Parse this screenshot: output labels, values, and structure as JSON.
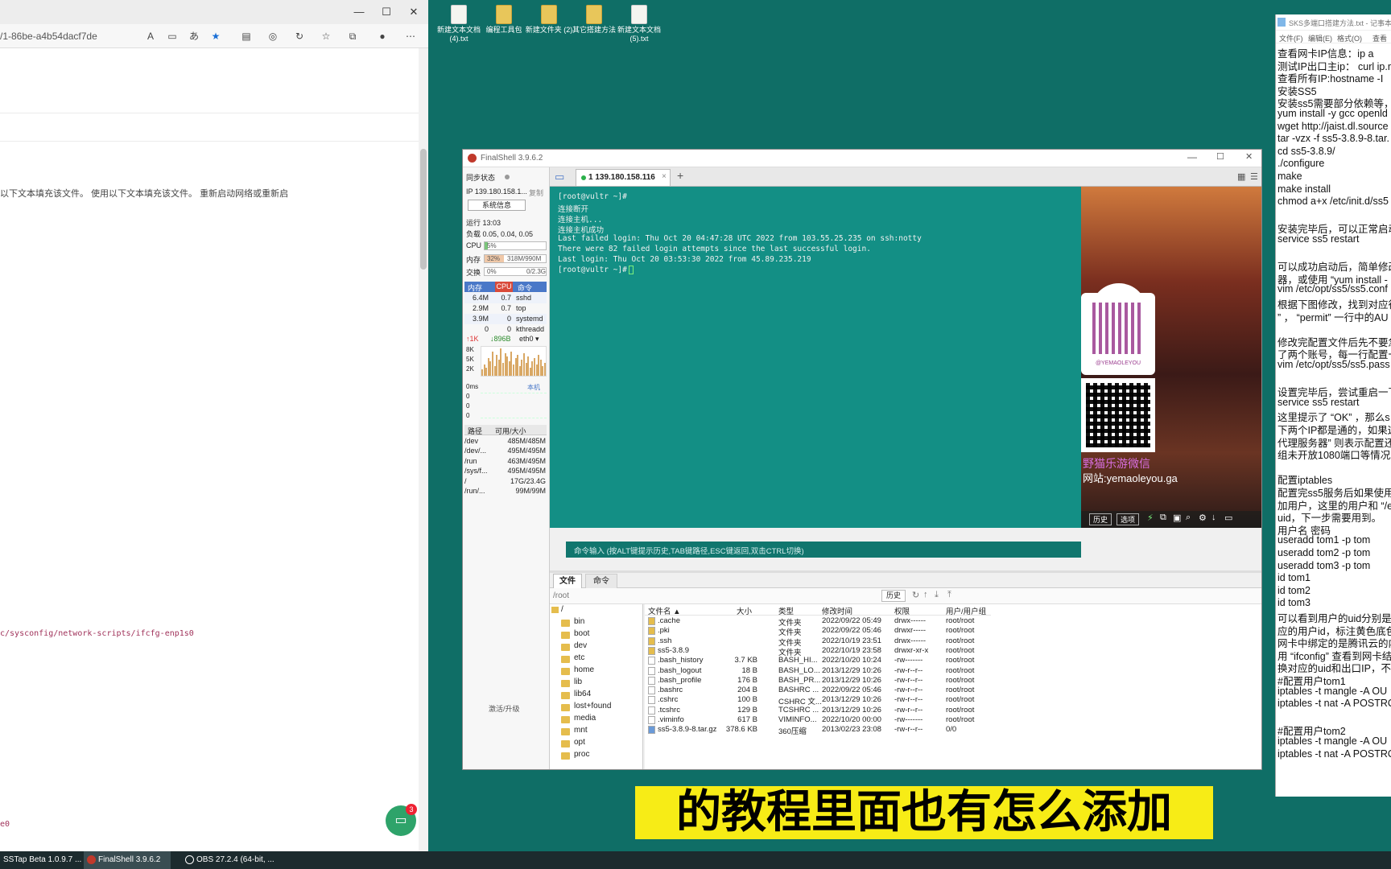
{
  "browser": {
    "url": "/1-86be-a4b54dacf7de",
    "text_line": "以下文本填充该文件。 使用以下文本填充该文件。 重新启动网络或重新启",
    "path_line": "c/sysconfig/network-scripts/ifcfg-enp1s0",
    "tail_text": "e0",
    "badge_count": "3"
  },
  "desktop_icons": [
    {
      "label": "新建文本文档 (4).txt",
      "type": "txt"
    },
    {
      "label": "编程工具包",
      "type": "folder"
    },
    {
      "label": "新建文件夹 (2)",
      "type": "folder"
    },
    {
      "label": "其它搭建方法",
      "type": "folder"
    },
    {
      "label": "新建文本文档 (5).txt",
      "type": "txt"
    }
  ],
  "finalshell": {
    "title": "FinalShell 3.9.6.2",
    "sidebar": {
      "sync_label": "同步状态",
      "ip_label": "IP 139.180.158.1...",
      "copy_label": "复制",
      "sysinfo_button": "系统信息",
      "uptime": "运行 13:03",
      "load": "负载 0.05, 0.04, 0.05",
      "cpu_label": "CPU",
      "cpu_value": "5%",
      "cpu_fraction": 0.05,
      "mem_label": "内存",
      "mem_pct": "32%",
      "mem_value": "318M/990M",
      "mem_fraction": 0.32,
      "swap_label": "交换",
      "swap_pct": "0%",
      "swap_value": "0/2.3G",
      "proc_headers": [
        "内存",
        "CPU",
        "命令"
      ],
      "processes": [
        {
          "mem": "6.4M",
          "cpu": "0.7",
          "cmd": "sshd"
        },
        {
          "mem": "2.9M",
          "cpu": "0.7",
          "cmd": "top"
        },
        {
          "mem": "3.9M",
          "cpu": "0",
          "cmd": "systemd"
        },
        {
          "mem": "0",
          "cpu": "0",
          "cmd": "kthreadd"
        }
      ],
      "net_up": "↑1K",
      "net_down": "↓896B",
      "net_iface": "eth0 ▾",
      "net_scale": [
        "8K",
        "5K",
        "2K"
      ],
      "latency_label": "0ms",
      "latency_host": "本机",
      "latency_vals": [
        "0",
        "0",
        "0"
      ],
      "disk_headers": [
        "路径",
        "可用/大小"
      ],
      "disks": [
        {
          "path": "/dev",
          "size": "485M/485M"
        },
        {
          "path": "/dev/...",
          "size": "495M/495M"
        },
        {
          "path": "/run",
          "size": "463M/495M"
        },
        {
          "path": "/sys/f...",
          "size": "495M/495M"
        },
        {
          "path": "/",
          "size": "17G/23.4G"
        },
        {
          "path": "/run/...",
          "size": "99M/99M"
        }
      ],
      "activate_label": "激活/升级"
    },
    "tab_label": "1 139.180.158.116",
    "terminal_lines": [
      "[root@vultr ~]#",
      "连接断开",
      "连接主机...",
      "连接主机成功",
      "Last failed login: Thu Oct 20 04:47:28 UTC 2022 from 103.55.25.235 on ssh:notty",
      "There were 82 failed login attempts since the last successful login.",
      "Last login: Thu Oct 20 03:53:30 2022 from 45.89.235.219",
      "[root@vultr ~]# "
    ],
    "ad": {
      "handle": "@YEMAOLEYOU",
      "line1": "野猫乐游微信",
      "line2": "网站:yemaoleyou.ga"
    },
    "cmd_placeholder": "命令输入 (按ALT键提示历史,TAB键路径,ESC键返回,双击CTRL切换)",
    "history_button": "历史",
    "options_button": "选项",
    "fm_tabs": [
      "文件",
      "命令"
    ],
    "fm_path": "/root",
    "fm_history_button": "历史",
    "tree_root": "/",
    "tree": [
      "bin",
      "boot",
      "dev",
      "etc",
      "home",
      "lib",
      "lib64",
      "lost+found",
      "media",
      "mnt",
      "opt",
      "proc"
    ],
    "file_headers": [
      "文件名 ▲",
      "大小",
      "类型",
      "修改时间",
      "权限",
      "用户/用户组"
    ],
    "files": [
      {
        "name": ".cache",
        "size": "",
        "type": "文件夹",
        "mtime": "2022/09/22 05:49",
        "perm": "drwx------",
        "owner": "root/root",
        "kind": "folder"
      },
      {
        "name": ".pki",
        "size": "",
        "type": "文件夹",
        "mtime": "2022/09/22 05:46",
        "perm": "drwxr-----",
        "owner": "root/root",
        "kind": "folder"
      },
      {
        "name": ".ssh",
        "size": "",
        "type": "文件夹",
        "mtime": "2022/10/19 23:51",
        "perm": "drwx------",
        "owner": "root/root",
        "kind": "folder"
      },
      {
        "name": "ss5-3.8.9",
        "size": "",
        "type": "文件夹",
        "mtime": "2022/10/19 23:58",
        "perm": "drwxr-xr-x",
        "owner": "root/root",
        "kind": "folder"
      },
      {
        "name": ".bash_history",
        "size": "3.7 KB",
        "type": "BASH_HI...",
        "mtime": "2022/10/20 10:24",
        "perm": "-rw-------",
        "owner": "root/root",
        "kind": "file"
      },
      {
        "name": ".bash_logout",
        "size": "18 B",
        "type": "BASH_LO...",
        "mtime": "2013/12/29 10:26",
        "perm": "-rw-r--r--",
        "owner": "root/root",
        "kind": "file"
      },
      {
        "name": ".bash_profile",
        "size": "176 B",
        "type": "BASH_PR...",
        "mtime": "2013/12/29 10:26",
        "perm": "-rw-r--r--",
        "owner": "root/root",
        "kind": "file"
      },
      {
        "name": ".bashrc",
        "size": "204 B",
        "type": "BASHRC ...",
        "mtime": "2022/09/22 05:46",
        "perm": "-rw-r--r--",
        "owner": "root/root",
        "kind": "file"
      },
      {
        "name": ".cshrc",
        "size": "100 B",
        "type": "CSHRC 文...",
        "mtime": "2013/12/29 10:26",
        "perm": "-rw-r--r--",
        "owner": "root/root",
        "kind": "file"
      },
      {
        "name": ".tcshrc",
        "size": "129 B",
        "type": "TCSHRC ...",
        "mtime": "2013/12/29 10:26",
        "perm": "-rw-r--r--",
        "owner": "root/root",
        "kind": "file"
      },
      {
        "name": ".viminfo",
        "size": "617 B",
        "type": "VIMINFO...",
        "mtime": "2022/10/20 00:00",
        "perm": "-rw-------",
        "owner": "root/root",
        "kind": "file"
      },
      {
        "name": "ss5-3.8.9-8.tar.gz",
        "size": "378.6 KB",
        "type": "360压缩",
        "mtime": "2013/02/23 23:08",
        "perm": "-rw-r--r--",
        "owner": "0/0",
        "kind": "archive"
      }
    ]
  },
  "notepad": {
    "title": "SKS多端口搭建方法.txt - 记事本",
    "menu": [
      "文件(F)",
      "编辑(E)",
      "格式(O)",
      "查看"
    ],
    "lines": [
      "查看网卡IP信息：ip a",
      "测试IP出口主ip：  curl ip.m",
      "查看所有IP:hostname -I",
      "安装SS5",
      "安装ss5需要部分依赖等，我",
      "yum install -y gcc openld",
      "wget http://jaist.dl.source",
      "tar -vzx -f ss5-3.8.9-8.tar.",
      "cd ss5-3.8.9/",
      "./configure",
      "make",
      "make install",
      "chmod a+x /etc/init.d/ss5",
      "",
      "安装完毕后，可以正常启动",
      "service ss5 restart",
      "",
      "可以成功启动后，简单修改",
      "器，或使用 “yum install -",
      "vim /etc/opt/ss5/ss5.conf",
      "根据下图修改，找到对应行",
      "” ， “permit” 一行中的AU",
      "",
      "修改完配置文件后先不要急",
      "了两个账号，每一行配置一",
      "vim /etc/opt/ss5/ss5.pass",
      "",
      "设置完毕后，尝试重启一下",
      "service ss5 restart",
      "这里提示了 “OK” ，那么s",
      "下两个IP都是通的，如果这",
      "代理服务器” 则表示配置还",
      "组未开放1080端口等情况。",
      "",
      "配置iptables",
      "配置完ss5服务后如果使用了",
      "加用户，这里的用户和 “/e",
      "uid，下一步需要用到。",
      "          用户名    密码",
      "useradd tom1 -p tom",
      "useradd tom2 -p tom",
      "useradd tom3 -p tom",
      "id tom1",
      "id tom2",
      "id tom3",
      "可以看到用户的uid分别是1",
      "应的用户id，标注黄色底色",
      "网卡中绑定的是腾讯云的内",
      "用 “ifconfig” 查看到网卡结",
      "换对应的uid和出口IP，不能",
      "#配置用户tom1",
      "iptables -t mangle -A OU",
      "iptables -t nat -A POSTRO",
      "",
      "#配置用户tom2",
      "iptables -t mangle -A OU",
      "iptables -t nat -A POSTRO"
    ]
  },
  "subtitle": "的教程里面也有怎么添加",
  "taskbar": [
    {
      "label": "SSTap Beta 1.0.9.7 ...",
      "active": false
    },
    {
      "label": "FinalShell 3.9.6.2",
      "active": true
    },
    {
      "label": "OBS 27.2.4 (64-bit, ...",
      "active": false
    }
  ]
}
